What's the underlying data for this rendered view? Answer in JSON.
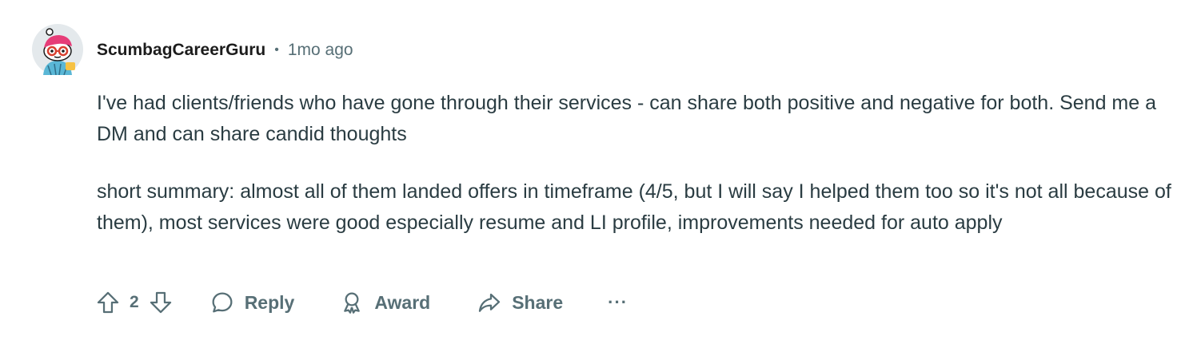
{
  "comment": {
    "author": "ScumbagCareerGuru",
    "separator": "•",
    "timestamp": "1mo ago",
    "paragraphs": [
      "I've had clients/friends who have gone through their services - can share both positive and negative for both. Send me a DM and can share candid thoughts",
      "short summary: almost all of them landed offers in timeframe (4/5, but I will say I helped them too so it's not all because of them), most services were good especially resume and LI profile, improvements needed for auto apply"
    ],
    "score": "2"
  },
  "actions": {
    "reply_label": "Reply",
    "award_label": "Award",
    "share_label": "Share",
    "more_label": "···"
  },
  "icons": {
    "upvote": "arrow-up-icon",
    "downvote": "arrow-down-icon",
    "reply": "speech-bubble-icon",
    "award": "award-icon",
    "share": "share-arrow-icon",
    "more": "ellipsis-icon"
  },
  "colors": {
    "meta_gray": "#576f76",
    "body_text": "#2a3c42",
    "author_text": "#1c1c1c"
  }
}
